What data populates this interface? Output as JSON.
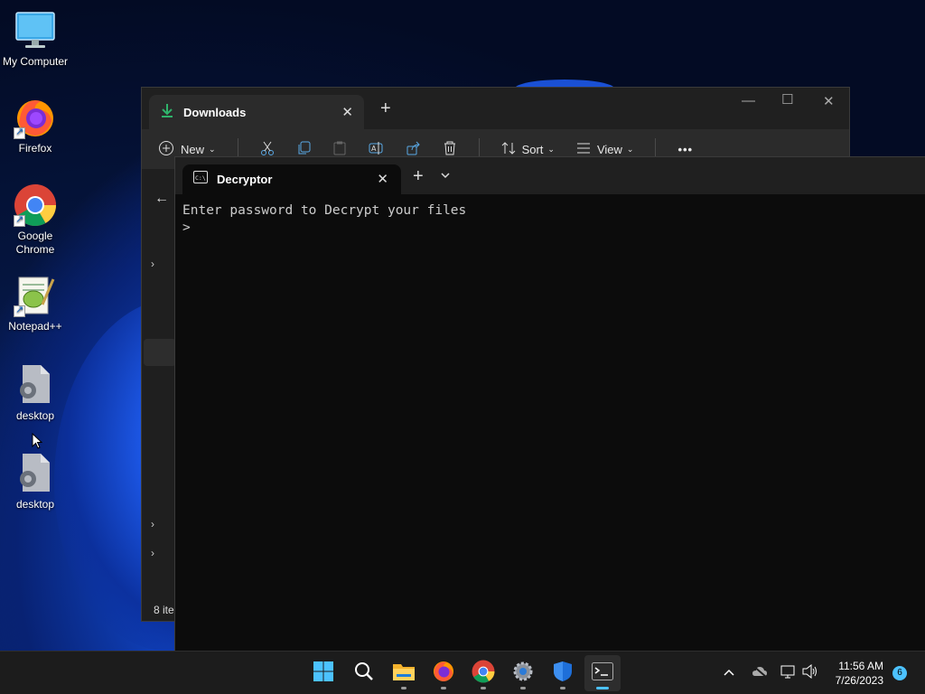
{
  "desktop": {
    "icons": [
      {
        "label": "My Computer",
        "icon": "monitor-icon"
      },
      {
        "label": "Firefox",
        "icon": "firefox-icon"
      },
      {
        "label": "Google Chrome",
        "icon": "chrome-icon"
      },
      {
        "label": "Notepad++",
        "icon": "notepad-plus-plus-icon"
      },
      {
        "label": "desktop",
        "icon": "settings-file-icon"
      },
      {
        "label": "desktop",
        "icon": "settings-file-icon"
      }
    ]
  },
  "explorer": {
    "tab_title": "Downloads",
    "toolbar": {
      "new_label": "New",
      "sort_label": "Sort",
      "view_label": "View"
    },
    "status": "8 ite"
  },
  "terminal": {
    "tab_title": "Decryptor",
    "lines": [
      "Enter password to Decrypt your files",
      ">"
    ]
  },
  "taskbar": {
    "apps": [
      "start",
      "search",
      "file-explorer",
      "firefox",
      "chrome",
      "settings",
      "defender",
      "terminal"
    ],
    "active_app": "terminal",
    "clock_time": "11:56 AM",
    "clock_date": "7/26/2023",
    "notification_count": "6"
  },
  "colors": {
    "accent": "#4cc2ff",
    "terminal_bg": "#0c0c0c",
    "terminal_text": "#cccccc",
    "downloads_icon": "#2fb36b"
  }
}
